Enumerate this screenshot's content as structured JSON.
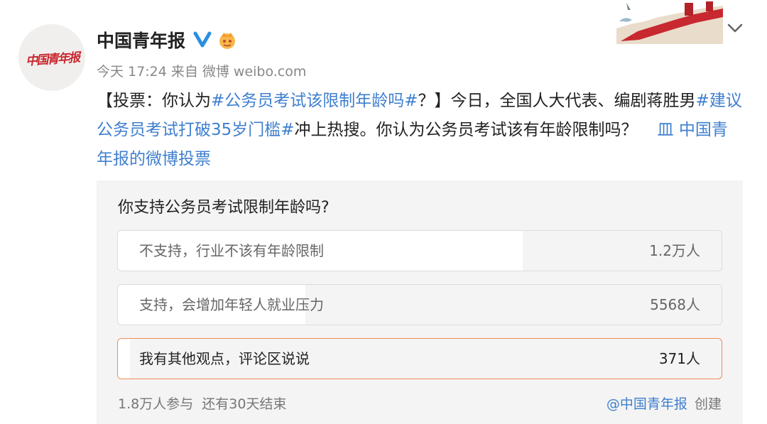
{
  "avatar": {
    "logo_text": "中国青年报"
  },
  "header": {
    "poster_name": "中国青年报",
    "meta": "今天 17:24 来自 微博 weibo.com"
  },
  "post": {
    "bracket_open": "【投票：你认为",
    "hashtag1": "#公务员考试该限制年龄吗#",
    "bracket_close": "？】今日，全国人大代表、编剧蒋胜男",
    "hashtag2": "#建议公务员考试打破35岁门槛#",
    "tail": "冲上热搜。你认为公务员考试该有年龄限制吗？",
    "vote_link": "皿 中国青年报的微博投票"
  },
  "poll": {
    "question": "你支持公务员考试限制年龄吗?",
    "options": [
      {
        "label": "不支持，行业不该有年龄限制",
        "count": "1.2万人",
        "share": 0.67
      },
      {
        "label": "支持，会增加年轻人就业压力",
        "count": "5568人",
        "share": 0.31
      },
      {
        "label": "我有其他观点，评论区说说",
        "count": "371人",
        "share": 0.02
      }
    ],
    "participants": "1.8万人参与",
    "remaining": "还有30天结束",
    "creator": "@中国青年报",
    "created": "创建"
  },
  "colors": {
    "link": "#3f7fcf",
    "selected_border": "#f08a5d",
    "brand_red": "#c8282f"
  },
  "icons": [
    "verified-icon",
    "member-crown-icon",
    "chevron-down-icon",
    "great-wall-art"
  ]
}
